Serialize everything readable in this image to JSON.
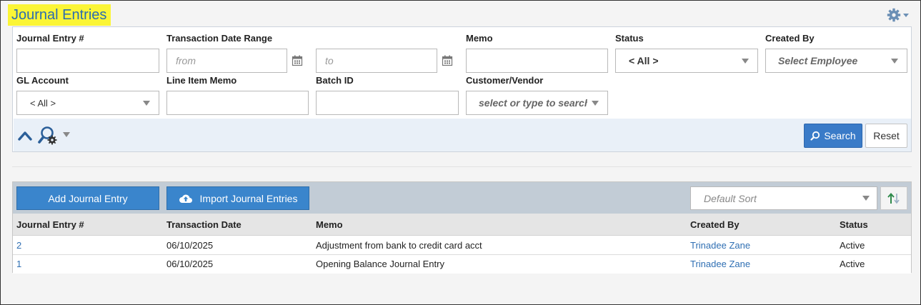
{
  "page": {
    "title": "Journal Entries"
  },
  "search": {
    "fields": {
      "journal_entry_label": "Journal Entry #",
      "journal_entry_value": "",
      "date_range_label": "Transaction Date Range",
      "date_from_placeholder": "from",
      "date_to_placeholder": "to",
      "memo_label": "Memo",
      "memo_value": "",
      "status_label": "Status",
      "status_value": "< All >",
      "created_by_label": "Created By",
      "created_by_placeholder": "Select Employee",
      "gl_account_label": "GL Account",
      "gl_account_value": "< All >",
      "line_item_memo_label": "Line Item Memo",
      "line_item_memo_value": "",
      "batch_id_label": "Batch ID",
      "batch_id_value": "",
      "customer_vendor_label": "Customer/Vendor",
      "customer_vendor_placeholder": "select or type to search"
    },
    "search_button": "Search",
    "reset_button": "Reset"
  },
  "results": {
    "add_button": "Add Journal Entry",
    "import_button": "Import Journal Entries",
    "sort_value": "Default Sort",
    "columns": [
      "Journal Entry #",
      "Transaction Date",
      "Memo",
      "Created By",
      "Status"
    ],
    "rows": [
      {
        "id": "2",
        "date": "06/10/2025",
        "memo": "Adjustment from bank to credit card acct",
        "created_by": "Trinadee Zane",
        "status": "Active"
      },
      {
        "id": "1",
        "date": "06/10/2025",
        "memo": "Opening Balance Journal Entry",
        "created_by": "Trinadee Zane",
        "status": "Active"
      }
    ]
  },
  "colors": {
    "title_highlight": "#fbf536",
    "title_text": "#2b6cb0",
    "primary_button": "#3a85cc",
    "link": "#2f6fb3",
    "toolbar_bg": "#c2ccd6"
  },
  "icons": [
    "gear-icon",
    "calendar-icon",
    "chevron-up-icon",
    "search-settings-icon",
    "dropdown-arrow-icon",
    "cloud-upload-icon",
    "sort-icon",
    "search-icon"
  ]
}
